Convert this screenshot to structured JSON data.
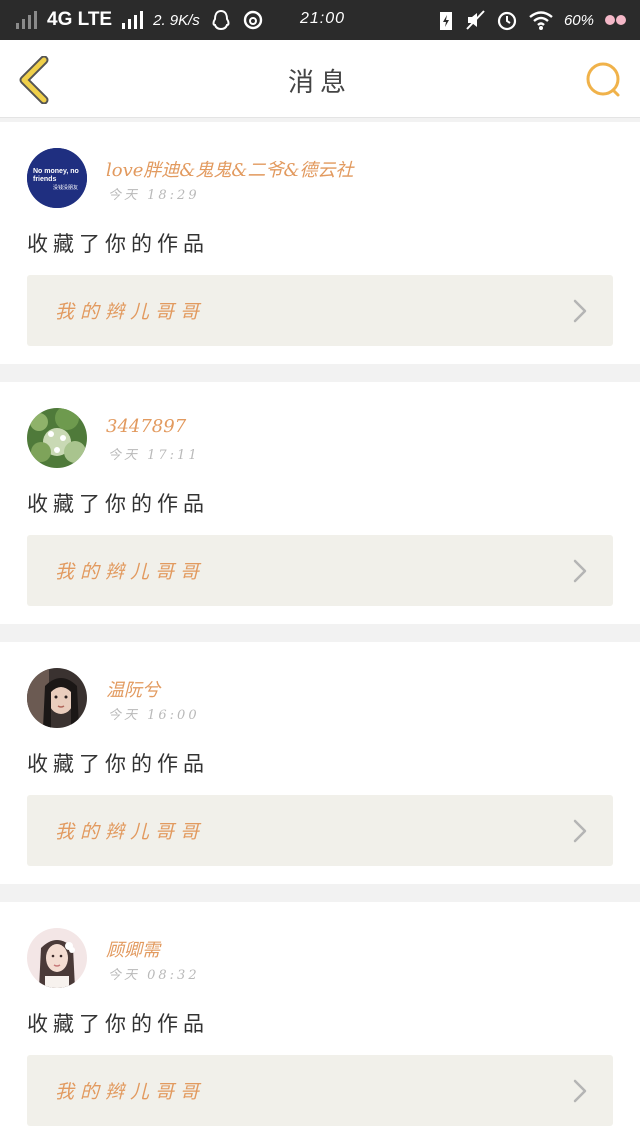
{
  "status_bar": {
    "carrier": "4G LTE",
    "speed": "2. 9K/s",
    "time": "21:00",
    "battery": "60%"
  },
  "nav": {
    "title": "消息",
    "back_icon": "chevron-left-icon",
    "search_icon": "search-icon",
    "accent_color": "#f0b24a"
  },
  "notifications": [
    {
      "username": "love胖迪&鬼鬼&二爷&德云社",
      "timestamp": "今天 18:29",
      "action": "收藏了你的作品",
      "work_title": "我的辫儿哥哥",
      "avatar_text_1": "No money, no",
      "avatar_text_2": "friends",
      "avatar_text_3": "没钱没朋友"
    },
    {
      "username": "3447897",
      "timestamp": "今天 17:11",
      "action": "收藏了你的作品",
      "work_title": "我的辫儿哥哥"
    },
    {
      "username": "温阮兮",
      "timestamp": "今天 16:00",
      "action": "收藏了你的作品",
      "work_title": "我的辫儿哥哥"
    },
    {
      "username": "顾卿需",
      "timestamp": "今天 08:32",
      "action": "收藏了你的作品",
      "work_title": "我的辫儿哥哥"
    }
  ]
}
